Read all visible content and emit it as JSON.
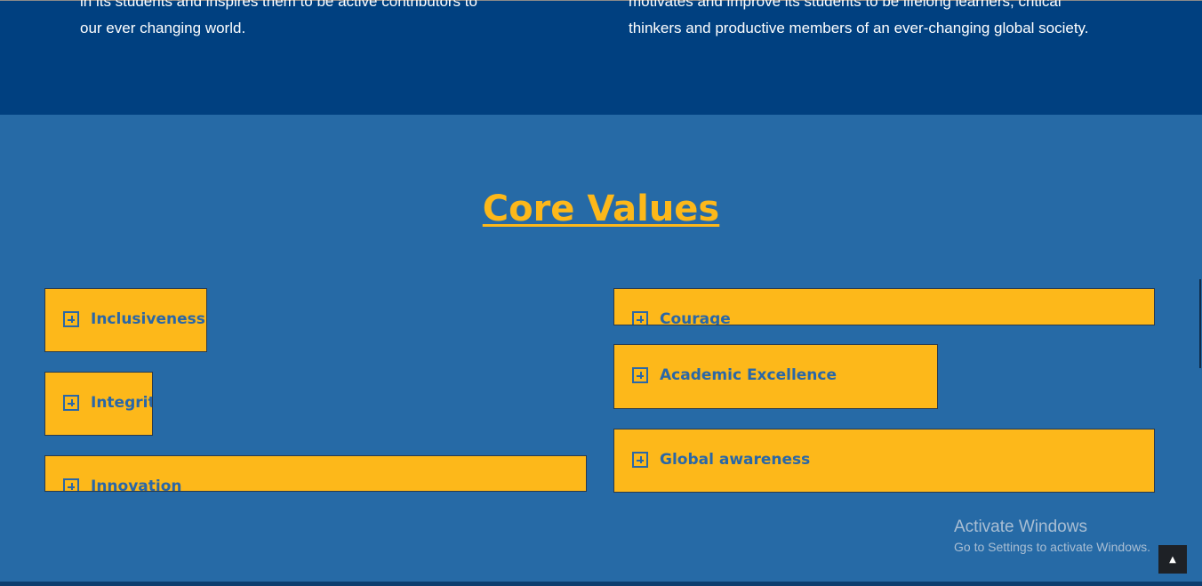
{
  "mission": {
    "left_line1": "in its students and inspires them to be active contributors to",
    "left_line2": "our ever changing world.",
    "right_line1": "motivates and improve its students to be lifelong learners, critical",
    "right_line2": "thinkers and productive members of an ever-changing global society."
  },
  "core_values": {
    "title": "Core Values",
    "items": [
      {
        "label": "Inclusiveness"
      },
      {
        "label": "Integrity"
      },
      {
        "label": "Innovation"
      },
      {
        "label": "Courage"
      },
      {
        "label": "Academic Excellence"
      },
      {
        "label": "Global awareness"
      }
    ]
  },
  "windows_notice": {
    "title": "Activate Windows",
    "subtitle": "Go to Settings to activate Windows."
  },
  "scroll_top": {
    "icon": "chevron-up-icon",
    "glyph": "▲"
  },
  "colors": {
    "top_band": "#004080",
    "section_bg": "#266aa6",
    "accent": "#fdb81a",
    "accordion_text": "#2a67a7"
  }
}
